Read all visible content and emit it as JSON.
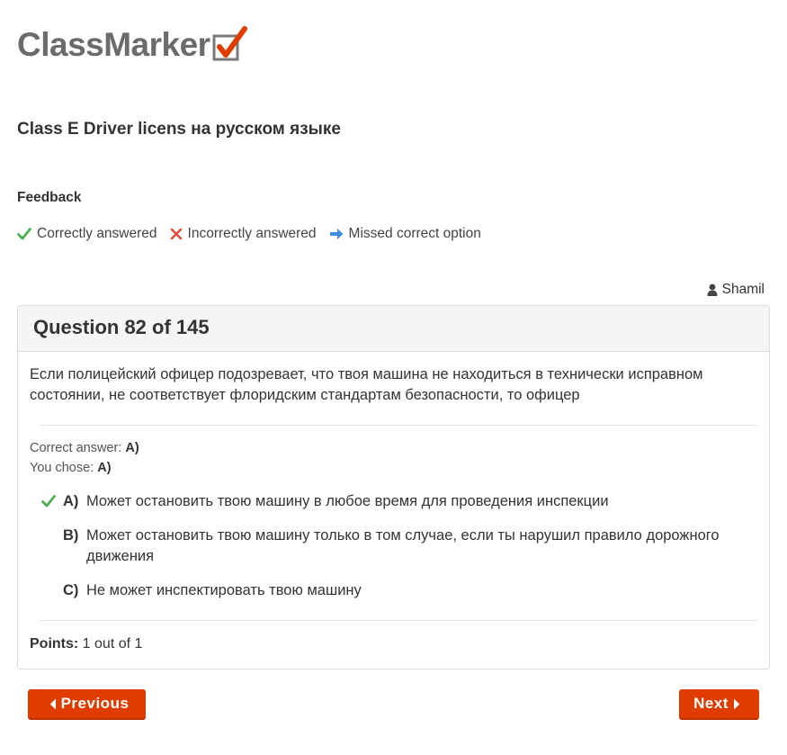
{
  "brand": {
    "name": "ClassMarker",
    "accent": "#e03c00"
  },
  "quiz": {
    "title": "Class E Driver licens на русском языке"
  },
  "feedback": {
    "heading": "Feedback",
    "legend": [
      {
        "icon": "check-icon",
        "label": "Correctly answered",
        "color": "#4caf50"
      },
      {
        "icon": "cross-icon",
        "label": "Incorrectly answered",
        "color": "#e74c3c"
      },
      {
        "icon": "arrow-right-icon",
        "label": "Missed correct option",
        "color": "#3d8fdb"
      }
    ]
  },
  "user": {
    "icon": "user-icon",
    "name": "Shamil"
  },
  "question": {
    "header": "Question 82 of 145",
    "text": "Если полицейский офицер подозревает, что твоя машина не находиться в технически исправном состоянии, не соответствует флоридским стандартам безопасности, то офицер",
    "correct_answer_label": "Correct answer:",
    "correct_answer_value": "A)",
    "you_chose_label": "You chose:",
    "you_chose_value": "A)",
    "options": [
      {
        "letter": "A)",
        "text": "Может остановить твою машину в любое время для проведения инспекции",
        "status": "correct"
      },
      {
        "letter": "B)",
        "text": "Может остановить твою машину только в том случае, если ты нарушил правило дорожного движения",
        "status": ""
      },
      {
        "letter": "C)",
        "text": "Не может инспектировать твою машину",
        "status": ""
      }
    ],
    "points_label": "Points:",
    "points_value": "1 out of 1"
  },
  "nav": {
    "previous_label": "Previous",
    "next_label": "Next"
  }
}
